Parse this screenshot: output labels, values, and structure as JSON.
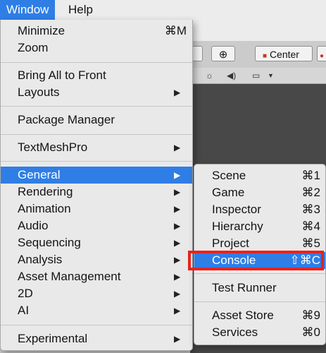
{
  "menubar": {
    "window_label": "Window",
    "help_label": "Help"
  },
  "toolbar": {
    "center_label": "Center"
  },
  "window_menu": {
    "minimize": {
      "label": "Minimize",
      "shortcut": "⌘M"
    },
    "zoom": {
      "label": "Zoom"
    },
    "bring_all_to_front": {
      "label": "Bring All to Front"
    },
    "layouts": {
      "label": "Layouts",
      "arrow": "▶"
    },
    "package_manager": {
      "label": "Package Manager"
    },
    "textmeshpro": {
      "label": "TextMeshPro",
      "arrow": "▶"
    },
    "general": {
      "label": "General",
      "arrow": "▶"
    },
    "rendering": {
      "label": "Rendering",
      "arrow": "▶"
    },
    "animation": {
      "label": "Animation",
      "arrow": "▶"
    },
    "audio": {
      "label": "Audio",
      "arrow": "▶"
    },
    "sequencing": {
      "label": "Sequencing",
      "arrow": "▶"
    },
    "analysis": {
      "label": "Analysis",
      "arrow": "▶"
    },
    "asset_management": {
      "label": "Asset Management",
      "arrow": "▶"
    },
    "two_d": {
      "label": "2D",
      "arrow": "▶"
    },
    "ai": {
      "label": "AI",
      "arrow": "▶"
    },
    "experimental": {
      "label": "Experimental",
      "arrow": "▶"
    }
  },
  "general_submenu": {
    "scene": {
      "label": "Scene",
      "shortcut": "⌘1"
    },
    "game": {
      "label": "Game",
      "shortcut": "⌘2"
    },
    "inspector": {
      "label": "Inspector",
      "shortcut": "⌘3"
    },
    "hierarchy": {
      "label": "Hierarchy",
      "shortcut": "⌘4"
    },
    "project": {
      "label": "Project",
      "shortcut": "⌘5"
    },
    "console": {
      "label": "Console",
      "shortcut": "⇧⌘C"
    },
    "test_runner": {
      "label": "Test Runner"
    },
    "asset_store": {
      "label": "Asset Store",
      "shortcut": "⌘9"
    },
    "services": {
      "label": "Services",
      "shortcut": "⌘0"
    }
  },
  "colors": {
    "highlight": "#2f7ee6",
    "annotation_box": "#e8221f"
  }
}
